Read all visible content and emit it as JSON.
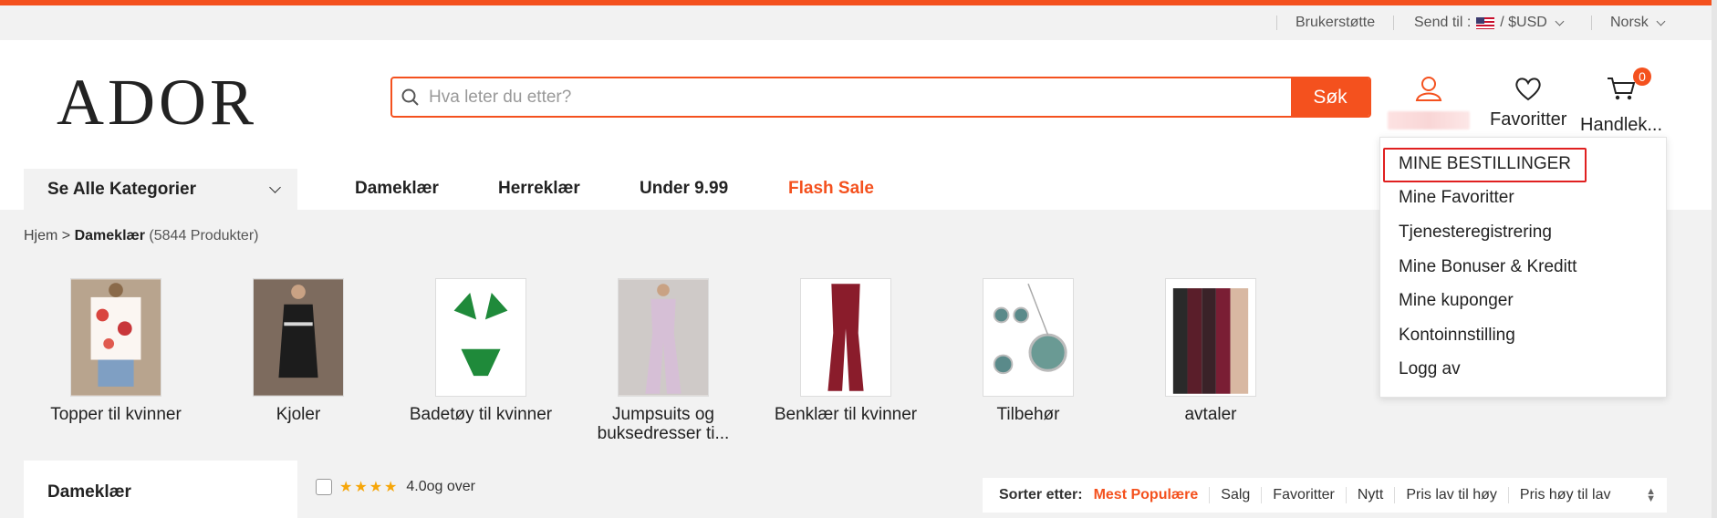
{
  "topbar": {
    "support": "Brukerstøtte",
    "ship_to": "Send til :",
    "currency": "/ $USD",
    "language": "Norsk"
  },
  "header": {
    "logo": "ADOR",
    "search_placeholder": "Hva leter du etter?",
    "search_button": "Søk",
    "favorites": "Favoritter",
    "cart": "Handlek...",
    "cart_count": "0"
  },
  "nav": {
    "all_categories": "Se Alle Kategorier",
    "items": [
      "Dameklær",
      "Herreklær",
      "Under 9.99",
      "Flash Sale"
    ]
  },
  "breadcrumb": {
    "home": "Hjem",
    "sep": ">",
    "current": "Dameklær",
    "count": "(5844 Produkter)"
  },
  "categories": [
    {
      "label": "Topper til kvinner"
    },
    {
      "label": "Kjoler"
    },
    {
      "label": "Badetøy til kvinner"
    },
    {
      "label": "Jumpsuits og buksedresser ti..."
    },
    {
      "label": "Benklær til kvinner"
    },
    {
      "label": "Tilbehør"
    },
    {
      "label": "avtaler"
    }
  ],
  "sidebar": {
    "title": "Dameklær"
  },
  "filter": {
    "rating": "4.0og over"
  },
  "sort": {
    "label": "Sorter etter:",
    "options": [
      "Mest Populære",
      "Salg",
      "Favoritter",
      "Nytt",
      "Pris lav til høy",
      "Pris høy til lav"
    ]
  },
  "account_menu": {
    "items": [
      "MINE BESTILLINGER",
      "Mine Favoritter",
      "Tjenesteregistrering",
      "Mine Bonuser & Kreditt",
      "Mine kuponger",
      "Kontoinnstilling",
      "Logg av"
    ]
  },
  "colors": {
    "accent": "#f4511e",
    "highlight_border": "#e02020"
  }
}
